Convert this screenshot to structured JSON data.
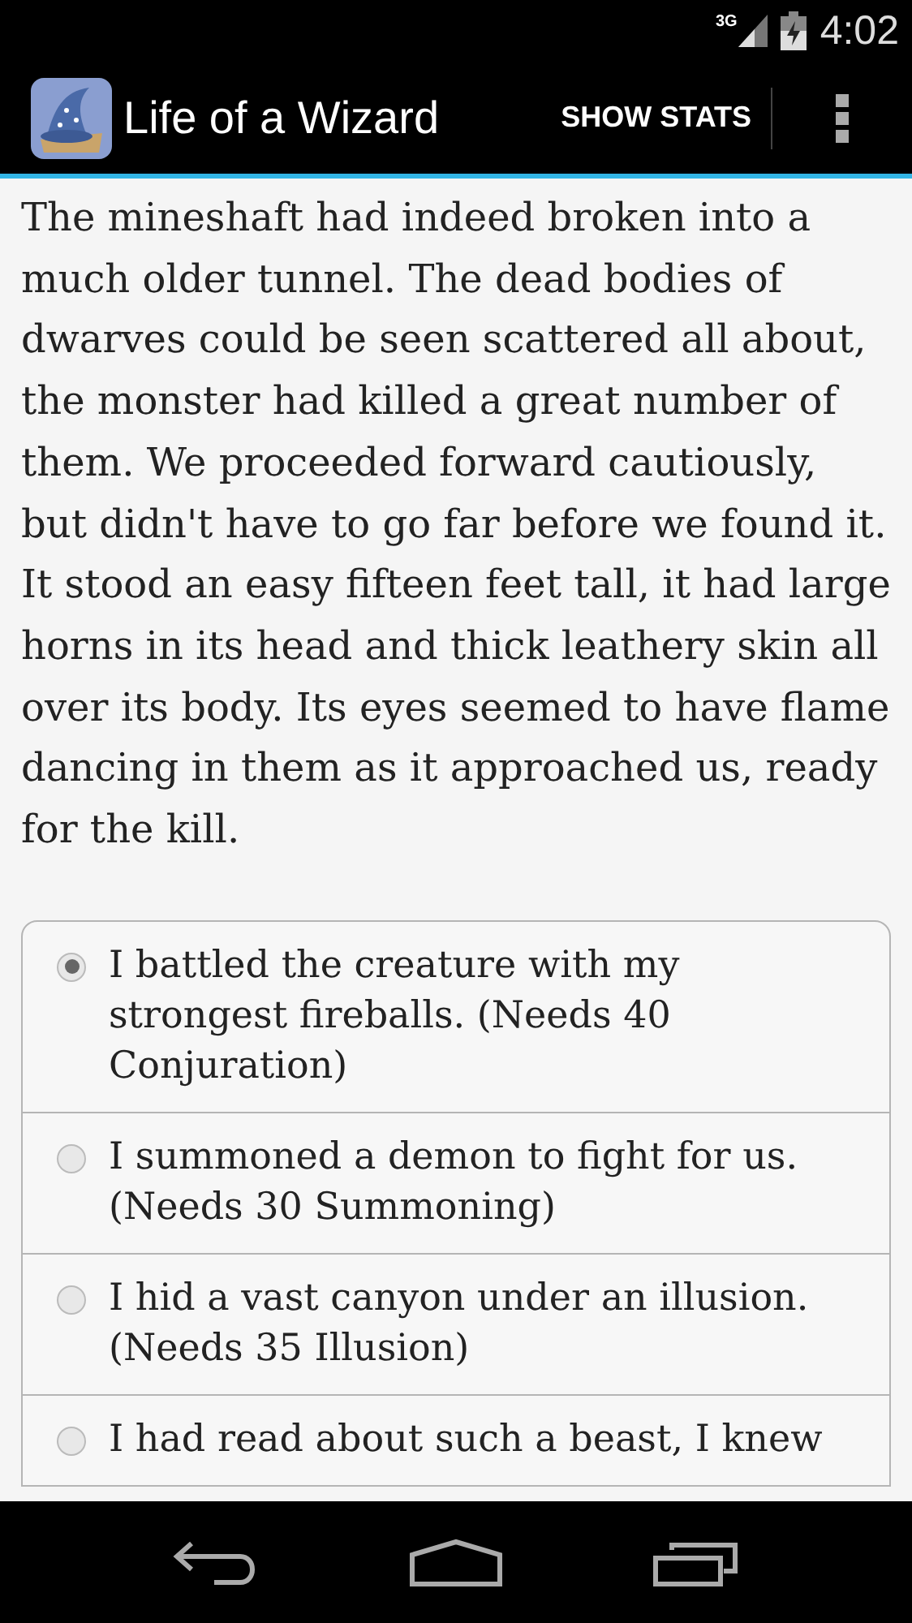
{
  "status_bar": {
    "network": "3G",
    "time": "4:02"
  },
  "action_bar": {
    "title": "Life of a Wizard",
    "action": "SHOW STATS"
  },
  "story": "The mineshaft had indeed broken into a much older tunnel. The dead bodies of dwarves could be seen scattered all about, the monster had killed a great number of them. We proceeded forward cautiously, but didn't have to go far before we found it. It stood an easy fifteen feet tall, it had large horns in its head and thick leathery skin all over its body. Its eyes seemed to have flame dancing in them as it approached us, ready for the kill.",
  "choices": [
    {
      "label": "I battled the creature with my strongest fireballs. (Needs 40 Conjuration)",
      "selected": true
    },
    {
      "label": "I summoned a demon to fight for us. (Needs 30 Summoning)",
      "selected": false
    },
    {
      "label": "I hid a vast canyon under an illusion. (Needs 35 Illusion)",
      "selected": false
    },
    {
      "label": "I had read about such a beast, I knew",
      "selected": false
    }
  ]
}
